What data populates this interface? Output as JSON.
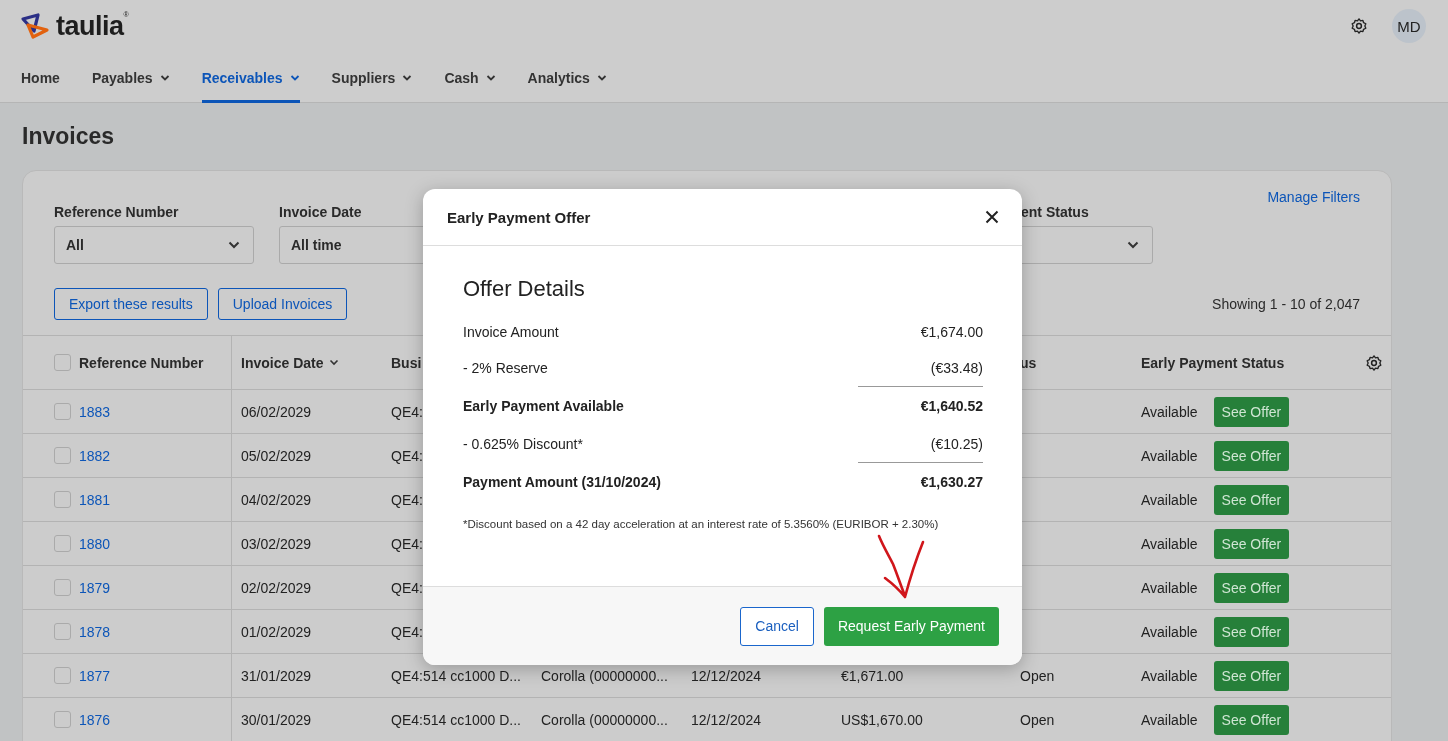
{
  "brand": {
    "name": "taulia",
    "mark": "®"
  },
  "user": {
    "initials": "MD"
  },
  "nav": [
    {
      "label": "Home",
      "has_menu": false,
      "selected": false
    },
    {
      "label": "Payables",
      "has_menu": true,
      "selected": false
    },
    {
      "label": "Receivables",
      "has_menu": true,
      "selected": true
    },
    {
      "label": "Suppliers",
      "has_menu": true,
      "selected": false
    },
    {
      "label": "Cash",
      "has_menu": true,
      "selected": false
    },
    {
      "label": "Analytics",
      "has_menu": true,
      "selected": false
    }
  ],
  "page_title": "Invoices",
  "manage_filters": "Manage Filters",
  "filters": [
    {
      "label": "Reference Number",
      "value": "All",
      "chevron": true
    },
    {
      "label": "Invoice Date",
      "value": "All time"
    },
    {
      "label": "ent Status",
      "chevron": true
    }
  ],
  "actions": [
    "Export these results",
    "Upload Invoices"
  ],
  "showing": "Showing 1 - 10 of 2,047",
  "table": {
    "select_all_checked": false,
    "header": {
      "reference": "Reference Number",
      "invoice_date": "Invoice Date",
      "column_3": "Busi",
      "column_7": "us",
      "early_payment_status": "Early Payment Status"
    },
    "rows": [
      {
        "checked": false,
        "reference": "1883",
        "invoice_date": "06/02/2029",
        "column_3": "QE4:",
        "early_payment_status": "Available",
        "action": "See Offer"
      },
      {
        "checked": false,
        "reference": "1882",
        "invoice_date": "05/02/2029",
        "column_3": "QE4:",
        "early_payment_status": "Available",
        "action": "See Offer"
      },
      {
        "checked": false,
        "reference": "1881",
        "invoice_date": "04/02/2029",
        "column_3": "QE4:",
        "early_payment_status": "Available",
        "action": "See Offer"
      },
      {
        "checked": false,
        "reference": "1880",
        "invoice_date": "03/02/2029",
        "column_3": "QE4:",
        "early_payment_status": "Available",
        "action": "See Offer"
      },
      {
        "checked": false,
        "reference": "1879",
        "invoice_date": "02/02/2029",
        "column_3": "QE4:",
        "early_payment_status": "Available",
        "action": "See Offer"
      },
      {
        "checked": false,
        "reference": "1878",
        "invoice_date": "01/02/2029",
        "column_3": "QE4:",
        "early_payment_status": "Available",
        "action": "See Offer"
      },
      {
        "checked": false,
        "reference": "1877",
        "invoice_date": "31/01/2029",
        "column_3": "QE4:514 cc1000 D...",
        "column_4": "Corolla (00000000...",
        "column_5": "12/12/2024",
        "column_6": "€1,671.00",
        "column_7": "Open",
        "early_payment_status": "Available",
        "action": "See Offer"
      },
      {
        "checked": false,
        "reference": "1876",
        "invoice_date": "30/01/2029",
        "column_3": "QE4:514 cc1000 D...",
        "column_4": "Corolla (00000000...",
        "column_5": "12/12/2024",
        "column_6": "US$1,670.00",
        "column_7": "Open",
        "early_payment_status": "Available",
        "action": "See Offer"
      }
    ]
  },
  "modal": {
    "title": "Early Payment Offer",
    "heading": "Offer Details",
    "lines": [
      {
        "kind": "item",
        "label": "Invoice Amount",
        "value": "€1,674.00"
      },
      {
        "kind": "item",
        "label": "- 2% Reserve",
        "value": "(€33.48)"
      },
      {
        "kind": "subtotal",
        "label": "Early Payment Available",
        "value": "€1,640.52"
      },
      {
        "kind": "item",
        "label": "- 0.625% Discount*",
        "value": "(€10.25)"
      },
      {
        "kind": "subtotal",
        "label": "Payment Amount (31/10/2024)",
        "value": "€1,630.27"
      }
    ],
    "footnote": "*Discount based on a 42 day acceleration at an interest rate of 5.3560% (EURIBOR + 2.30%)",
    "cancel": "Cancel",
    "confirm": "Request Early Payment"
  }
}
